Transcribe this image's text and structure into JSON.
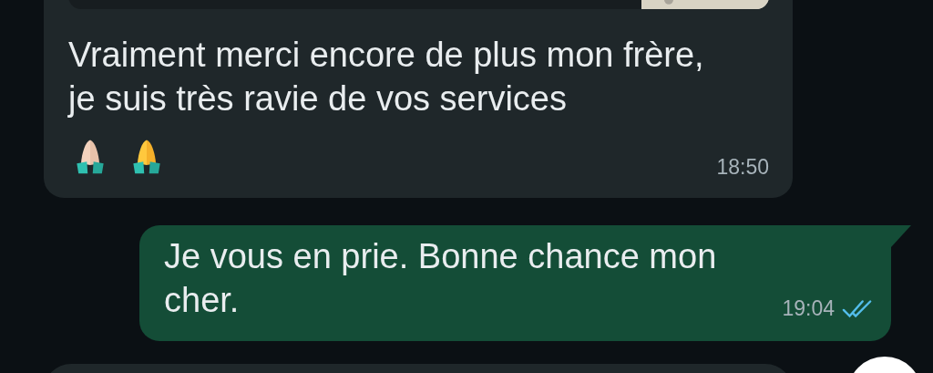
{
  "messages": [
    {
      "kind": "incoming",
      "has_quote": true,
      "text": "Vraiment merci encore de plus mon frère, je suis très ravie de vos services",
      "time": "18:50"
    },
    {
      "kind": "outgoing",
      "text": "Je vous en prie. Bonne chance mon cher.",
      "time": "19:04",
      "read": true
    }
  ]
}
